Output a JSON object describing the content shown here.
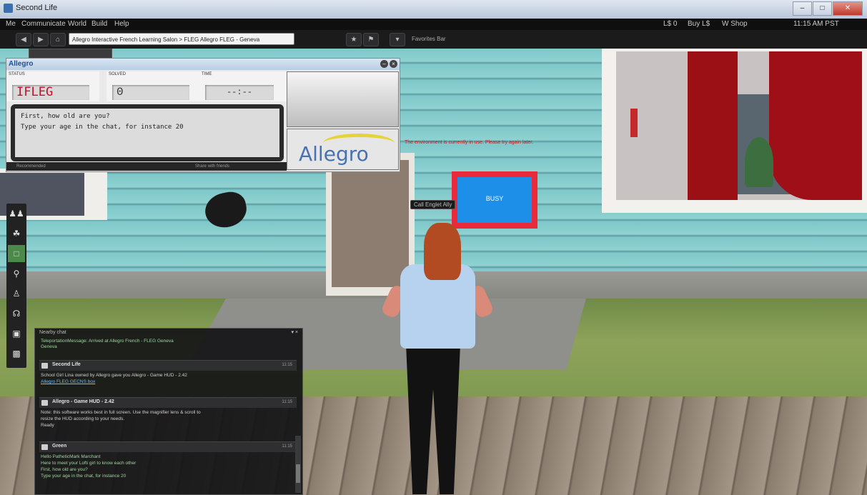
{
  "window": {
    "title": "Second Life"
  },
  "menu": {
    "items": [
      "Me",
      "Communicate",
      "World",
      "Build",
      "Help"
    ],
    "right_items": [
      "L$ 0",
      "Buy L$",
      "W Shop",
      "11:15 AM PST"
    ]
  },
  "nav": {
    "url": "Allegro Interactive French Learning Salon > FLEG Allegro FLEG - Geneva",
    "favorites_label": "Favorites Bar"
  },
  "hud": {
    "logo": "Allegro",
    "status_label": "STATUS",
    "status_value": "IFLEG",
    "solved_label": "SOLVED",
    "solved_value": "0",
    "time_label": "TIME",
    "time_value": "--:--",
    "prompt_line1": "First, how old are you?",
    "prompt_line2": "Type your age in the chat, for instance 20",
    "footer_left": "Recommended",
    "footer_right": "Share with friends",
    "brand": "Allegro"
  },
  "scene": {
    "message": "The environment is currently in use. Please try again later.",
    "busy_label": "BUSY",
    "hover_label": "Call Englet Ally"
  },
  "toolbar": {
    "icons": [
      "people-icon",
      "outfit-icon",
      "chat-icon",
      "search-icon",
      "person-icon",
      "headset-icon",
      "snapshot-icon",
      "camera-icon"
    ]
  },
  "chat": {
    "header": "Nearby chat",
    "intro_lines": [
      "TeleportationMessage: Arrived at Allegro French - FLEG Geneva",
      "Geneva"
    ],
    "messages": [
      {
        "sender": "Second Life",
        "time": "11:15",
        "lines": [
          "School Girl Lina owned by Allegro gave you Allegro - Game HUD - 2.42",
          "Allegro FLEG GECNS box"
        ]
      },
      {
        "sender": "Allegro - Game HUD - 2.42",
        "time": "11:15",
        "lines": [
          "Note: this software works best in full screen. Use the magnifier lens & scroll to",
          "resize the HUD according to your needs.",
          "Ready"
        ]
      },
      {
        "sender": "Green",
        "time": "11:15",
        "lines": [
          "Hello PatheticMark Marchant",
          "Here to meet your Lofti girl to know each other",
          "First, how old are you?",
          "Type your age in the chat, for instance 20"
        ]
      }
    ]
  },
  "colors": {
    "busy_frame": "#ea2a3a",
    "busy_screen": "#1e8fe8",
    "status_red": "#c2112b"
  }
}
